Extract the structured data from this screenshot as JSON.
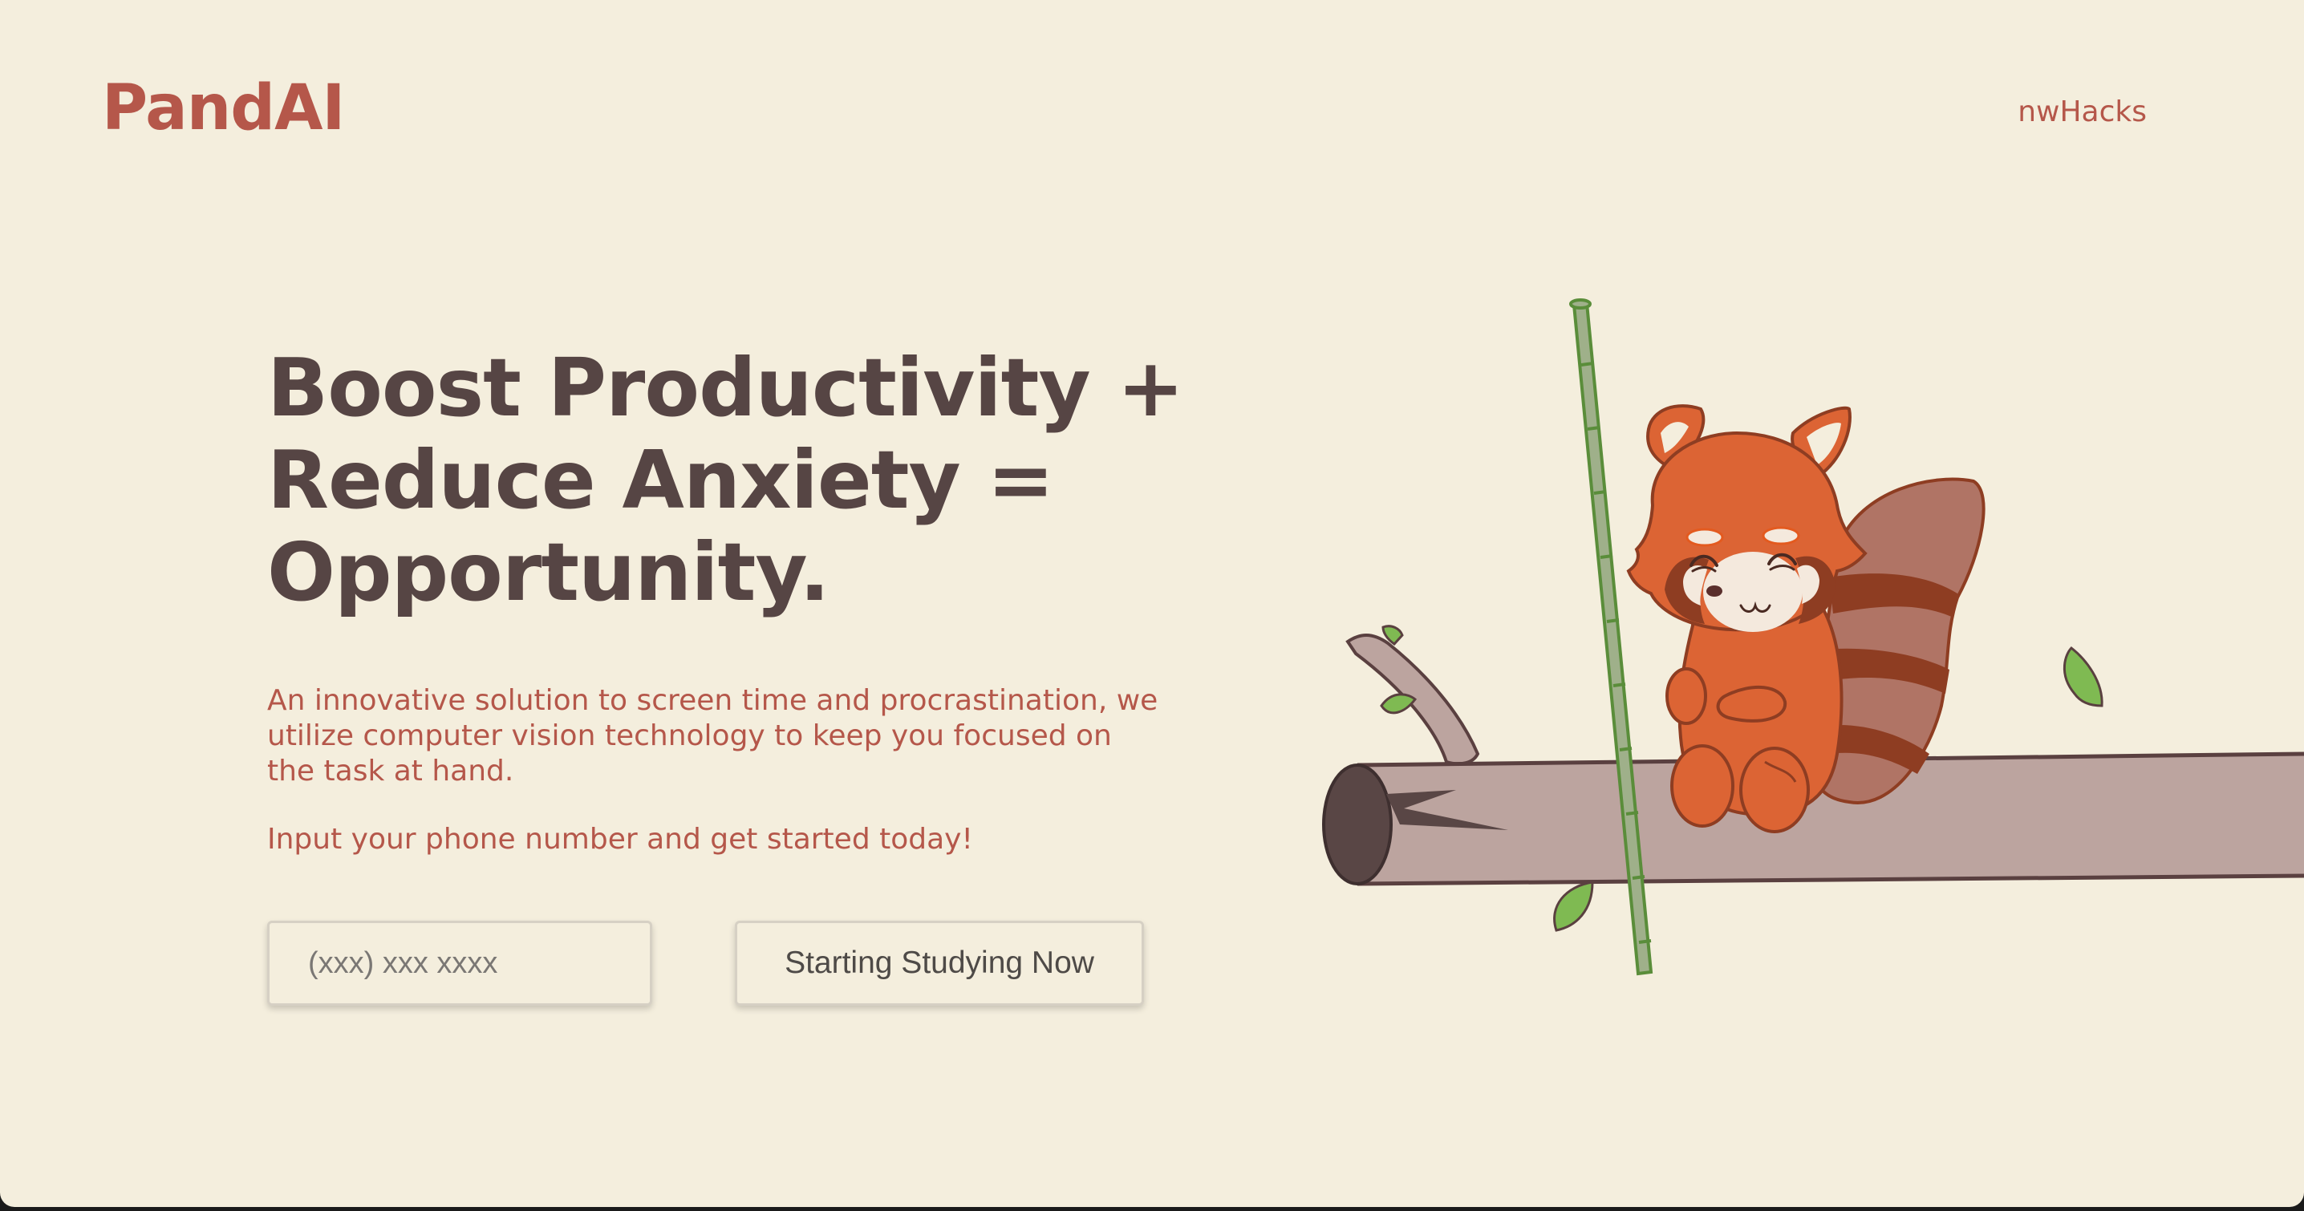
{
  "header": {
    "logo": "PandAI",
    "nav_link": "nwHacks"
  },
  "hero": {
    "headline_lines": [
      "Boost Productivity +",
      "Reduce Anxiety =",
      "Opportunity."
    ],
    "description": "An innovative solution to screen time and procrastination, we utilize computer vision technology to keep you focused on the task at hand.",
    "cta_text": "Input your phone number and get started today!",
    "phone_placeholder": "(xxx) xxx xxxx",
    "phone_value": "",
    "start_button_label": "Starting Studying Now"
  },
  "illustration": {
    "subject": "red-panda-on-log-with-bamboo",
    "colors": {
      "panda_fur": "#dc6434",
      "panda_dark": "#8e3d22",
      "tail_light": "#b07465",
      "log": "#bca49f",
      "log_end": "#594645",
      "bamboo": "#9fb08a",
      "leaf": "#7fba52",
      "outline": "#5a4040"
    }
  },
  "colors": {
    "background": "#f4eedd",
    "accent": "#b5574a",
    "heading": "#564544"
  }
}
